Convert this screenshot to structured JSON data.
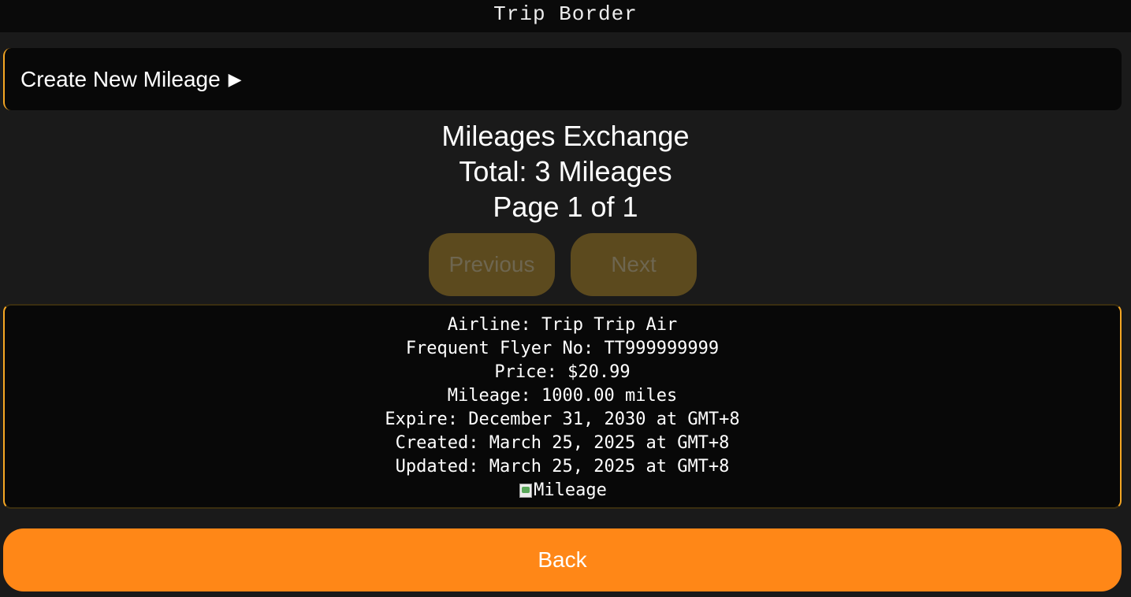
{
  "app": {
    "title": "Trip Border"
  },
  "create_panel": {
    "label": "Create New Mileage",
    "arrow": "▶"
  },
  "header": {
    "title": "Mileages Exchange",
    "total": "Total: 3 Mileages",
    "page": "Page 1 of 1"
  },
  "pagination": {
    "previous_label": "Previous",
    "next_label": "Next",
    "previous_enabled": false,
    "next_enabled": false
  },
  "mileage_card": {
    "airline": "Airline: Trip Trip Air",
    "flyer_no": "Frequent Flyer No: TT999999999",
    "price": "Price: $20.99",
    "mileage": "Mileage: 1000.00 miles",
    "expire": "Expire: December 31, 2030 at GMT+8",
    "created": "Created: March 25, 2025 at GMT+8",
    "updated": "Updated: March 25, 2025 at GMT+8",
    "image_alt": "Mileage"
  },
  "footer": {
    "back_label": "Back"
  },
  "colors": {
    "accent": "#ff8717",
    "border_accent": "#f5a623",
    "background": "#1a1a1a",
    "panel": "#080808",
    "disabled_button": "#5c4a1e"
  },
  "icons": {
    "create_arrow": "play-triangle-icon",
    "image_placeholder": "broken-image-icon"
  }
}
